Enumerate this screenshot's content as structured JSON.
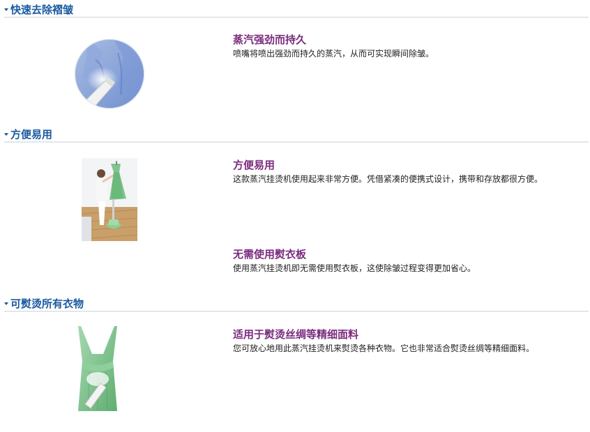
{
  "sections": [
    {
      "title": "快速去除褶皱",
      "image_icon": "shirt-steaming-icon",
      "features": [
        {
          "title": "蒸汽强劲而持久",
          "desc": "喷嘴将喷出强劲而持久的蒸汽，从而可实现瞬间除皱。"
        }
      ]
    },
    {
      "title": "方便易用",
      "image_icon": "woman-using-steamer-icon",
      "features": [
        {
          "title": "方便易用",
          "desc": "这款蒸汽挂烫机使用起来非常方便。凭借紧凑的便携式设计，携带和存放都很方便。"
        },
        {
          "title": "无需使用熨衣板",
          "desc": "使用蒸汽挂烫机即无需使用熨衣板，这使除皱过程变得更加省心。"
        }
      ]
    },
    {
      "title": "可熨烫所有衣物",
      "image_icon": "silk-dress-steaming-icon",
      "features": [
        {
          "title": "适用于熨烫丝绸等精细面料",
          "desc": "您可放心地用此蒸汽挂烫机来熨烫各种衣物。它也非常适合熨烫丝绸等精细面料。"
        }
      ]
    }
  ],
  "colors": {
    "section_title": "#1a5aa0",
    "feature_title": "#7a2c7e",
    "body_text": "#222222",
    "divider": "#d8dde3"
  }
}
